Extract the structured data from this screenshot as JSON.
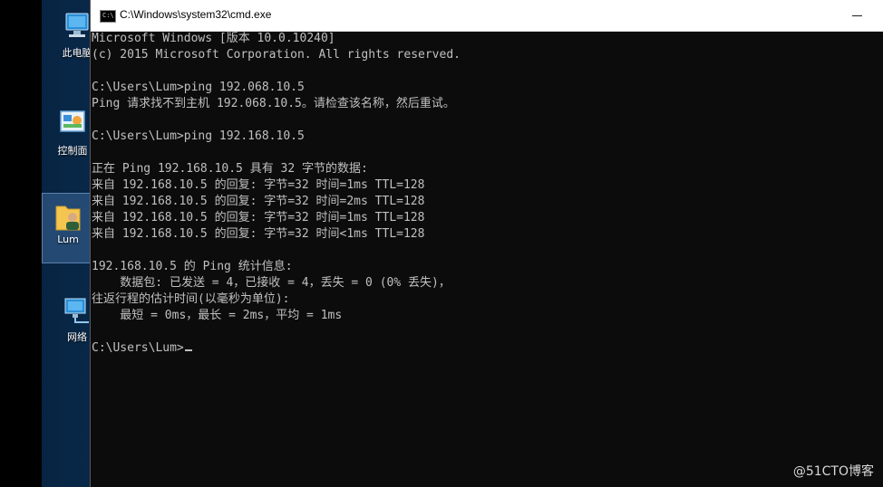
{
  "desktop": {
    "icons": [
      {
        "label": "此电脑",
        "icon": "computer-icon"
      },
      {
        "label": "控制面",
        "icon": "control-panel-icon"
      },
      {
        "label": "Lum",
        "icon": "user-folder-icon"
      },
      {
        "label": "网络",
        "icon": "network-icon"
      }
    ]
  },
  "window": {
    "title": "C:\\Windows\\system32\\cmd.exe",
    "icon_text": "C:\\"
  },
  "console": {
    "lines": [
      "Microsoft Windows [版本 10.0.10240]",
      "(c) 2015 Microsoft Corporation. All rights reserved.",
      "",
      "C:\\Users\\Lum>ping 192.068.10.5",
      "Ping 请求找不到主机 192.068.10.5。请检查该名称，然后重试。",
      "",
      "C:\\Users\\Lum>ping 192.168.10.5",
      "",
      "正在 Ping 192.168.10.5 具有 32 字节的数据:",
      "来自 192.168.10.5 的回复: 字节=32 时间=1ms TTL=128",
      "来自 192.168.10.5 的回复: 字节=32 时间=2ms TTL=128",
      "来自 192.168.10.5 的回复: 字节=32 时间=1ms TTL=128",
      "来自 192.168.10.5 的回复: 字节=32 时间<1ms TTL=128",
      "",
      "192.168.10.5 的 Ping 统计信息:",
      "    数据包: 已发送 = 4，已接收 = 4，丢失 = 0 (0% 丢失)，",
      "往返行程的估计时间(以毫秒为单位):",
      "    最短 = 0ms，最长 = 2ms，平均 = 1ms",
      ""
    ],
    "prompt": "C:\\Users\\Lum>"
  },
  "watermark": "@51CTO博客",
  "colors": {
    "console_bg": "#0c0c0c",
    "console_fg": "#c0c0c0",
    "titlebar_bg": "#ffffff"
  }
}
